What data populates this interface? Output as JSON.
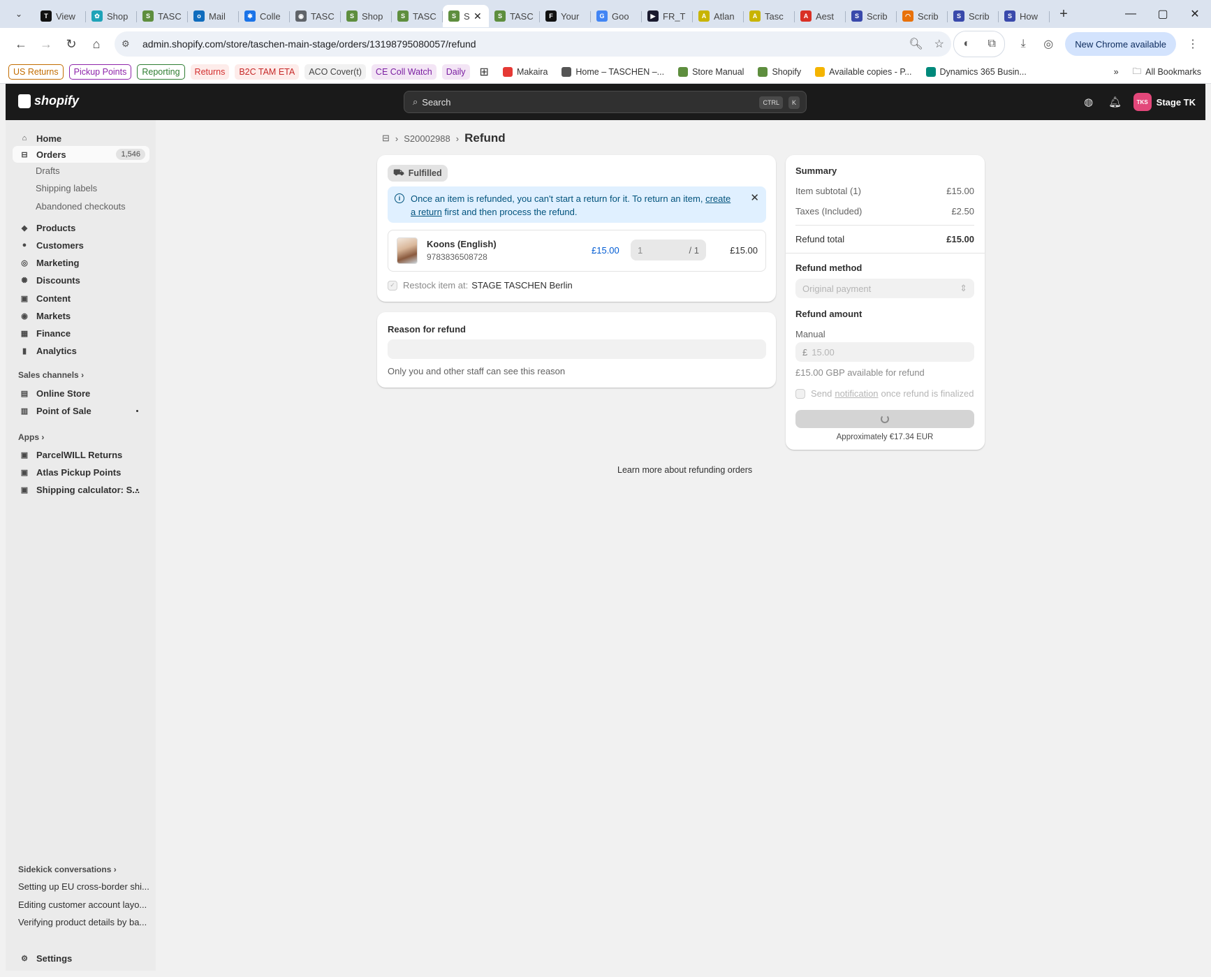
{
  "browser": {
    "tabs": [
      {
        "title": "View",
        "favicon_color": "#111111",
        "favicon_glyph": "T"
      },
      {
        "title": "Shop",
        "favicon_color": "#1fa3b8",
        "favicon_glyph": "✿"
      },
      {
        "title": "TASC",
        "favicon_color": "#5e8e3e",
        "favicon_glyph": "S"
      },
      {
        "title": "Mail",
        "favicon_color": "#0f6cbd",
        "favicon_glyph": "o"
      },
      {
        "title": "Colle",
        "favicon_color": "#1a73e8",
        "favicon_glyph": "✱"
      },
      {
        "title": "TASC",
        "favicon_color": "#5f6368",
        "favicon_glyph": "◉"
      },
      {
        "title": "Shop",
        "favicon_color": "#5e8e3e",
        "favicon_glyph": "S"
      },
      {
        "title": "TASC",
        "favicon_color": "#5e8e3e",
        "favicon_glyph": "S"
      },
      {
        "title": "S",
        "favicon_color": "#5e8e3e",
        "favicon_glyph": "S",
        "active": true
      },
      {
        "title": "TASC",
        "favicon_color": "#5e8e3e",
        "favicon_glyph": "S"
      },
      {
        "title": "Your",
        "favicon_color": "#111111",
        "favicon_glyph": "F"
      },
      {
        "title": "Goo",
        "favicon_color": "#4285f4",
        "favicon_glyph": "G"
      },
      {
        "title": "FR_T",
        "favicon_color": "#1a1a2e",
        "favicon_glyph": "▶"
      },
      {
        "title": "Atlan",
        "favicon_color": "#c8b400",
        "favicon_glyph": "A"
      },
      {
        "title": "Tasc",
        "favicon_color": "#c8b400",
        "favicon_glyph": "A"
      },
      {
        "title": "Aest",
        "favicon_color": "#d93025",
        "favicon_glyph": "A"
      },
      {
        "title": "Scrib",
        "favicon_color": "#3949ab",
        "favicon_glyph": "S"
      },
      {
        "title": "Scrib",
        "favicon_color": "#e8710a",
        "favicon_glyph": "◠"
      },
      {
        "title": "Scrib",
        "favicon_color": "#3949ab",
        "favicon_glyph": "S"
      },
      {
        "title": "How",
        "favicon_color": "#3949ab",
        "favicon_glyph": "S"
      }
    ],
    "url": "admin.shopify.com/store/taschen-main-stage/orders/13198795080057/refund",
    "new_chrome_label": "New Chrome available",
    "bookmarks": [
      {
        "label": "US Returns",
        "color": "#c26c00",
        "pill": true
      },
      {
        "label": "Pickup Points",
        "color": "#8e24aa",
        "pill": true
      },
      {
        "label": "Reporting",
        "color": "#2e7d32",
        "pill": true
      },
      {
        "label": "Returns",
        "color": "#d32f2f",
        "pill": false,
        "bg": "#fdecea"
      },
      {
        "label": "B2C TAM ETA",
        "color": "#c62828",
        "pill": false,
        "bg": "#fdecea"
      },
      {
        "label": "ACO Cover(t)",
        "color": "#444444",
        "pill": false,
        "bg": "#f1f1f1"
      },
      {
        "label": "CE Coll Watch",
        "color": "#7b1fa2",
        "pill": false,
        "bg": "#f3e5f5"
      },
      {
        "label": "Daily",
        "color": "#7b1fa2",
        "pill": false,
        "bg": "#f3e5f5"
      }
    ],
    "bookmarks_links": [
      {
        "label": "Makaira",
        "icon_color": "#e53935"
      },
      {
        "label": "Home – TASCHEN –...",
        "icon_color": "#555555"
      },
      {
        "label": "Store Manual",
        "icon_color": "#5e8e3e"
      },
      {
        "label": "Shopify",
        "icon_color": "#5e8e3e"
      },
      {
        "label": "Available copies - P...",
        "icon_color": "#f4b400"
      },
      {
        "label": "Dynamics 365 Busin...",
        "icon_color": "#00897b"
      }
    ],
    "all_bookmarks_label": "All Bookmarks"
  },
  "shopify": {
    "logo_text": "shopify",
    "search_placeholder": "Search",
    "search_kbd_1": "CTRL",
    "search_kbd_2": "K",
    "store_initials": "TKS",
    "store_name": "Stage TK"
  },
  "sidebar": {
    "home": "Home",
    "orders": "Orders",
    "orders_count": "1,546",
    "drafts": "Drafts",
    "shipping_labels": "Shipping labels",
    "abandoned": "Abandoned checkouts",
    "products": "Products",
    "customers": "Customers",
    "marketing": "Marketing",
    "discounts": "Discounts",
    "content": "Content",
    "markets": "Markets",
    "finance": "Finance",
    "analytics": "Analytics",
    "sales_channels": "Sales channels",
    "online_store": "Online Store",
    "pos": "Point of Sale",
    "apps": "Apps",
    "app_parcelwill": "ParcelWILL Returns",
    "app_atlas": "Atlas Pickup Points",
    "app_shipping": "Shipping calculator: S...",
    "sidekick": "Sidekick conversations",
    "conv_1": "Setting up EU cross-border shi...",
    "conv_2": "Editing customer account layo...",
    "conv_3": "Verifying product details by ba...",
    "settings": "Settings"
  },
  "page": {
    "order_number": "S20002988",
    "title": "Refund",
    "status_badge": "Fulfilled",
    "banner_text_1": "Once an item is refunded, you can't start a return for it. To return an item, ",
    "banner_link": "create a return",
    "banner_text_2": " first and then process the refund.",
    "item_name": "Koons (English)",
    "item_sku": "9783836508728",
    "item_price": "£15.00",
    "item_qty": "1",
    "item_qty_max": "/ 1",
    "item_total": "£15.00",
    "restock_label": "Restock item at:",
    "restock_location": "STAGE TASCHEN Berlin",
    "reason_title": "Reason for refund",
    "reason_value": "",
    "reason_help": "Only you and other staff can see this reason",
    "learn_more": "Learn more about refunding orders"
  },
  "summary": {
    "title": "Summary",
    "subtotal_label": "Item subtotal (1)",
    "subtotal_value": "£15.00",
    "taxes_label": "Taxes (Included)",
    "taxes_value": "£2.50",
    "total_label": "Refund total",
    "total_value": "£15.00",
    "method_label": "Refund method",
    "method_value": "Original payment",
    "amount_label": "Refund amount",
    "manual_label": "Manual",
    "currency_symbol": "£",
    "amount_value": "15.00",
    "available": "£15.00 GBP available for refund",
    "notify_pre": "Send",
    "notify_link": "notification",
    "notify_post": "once refund is finalized",
    "approx": "Approximately €17.34 EUR"
  }
}
